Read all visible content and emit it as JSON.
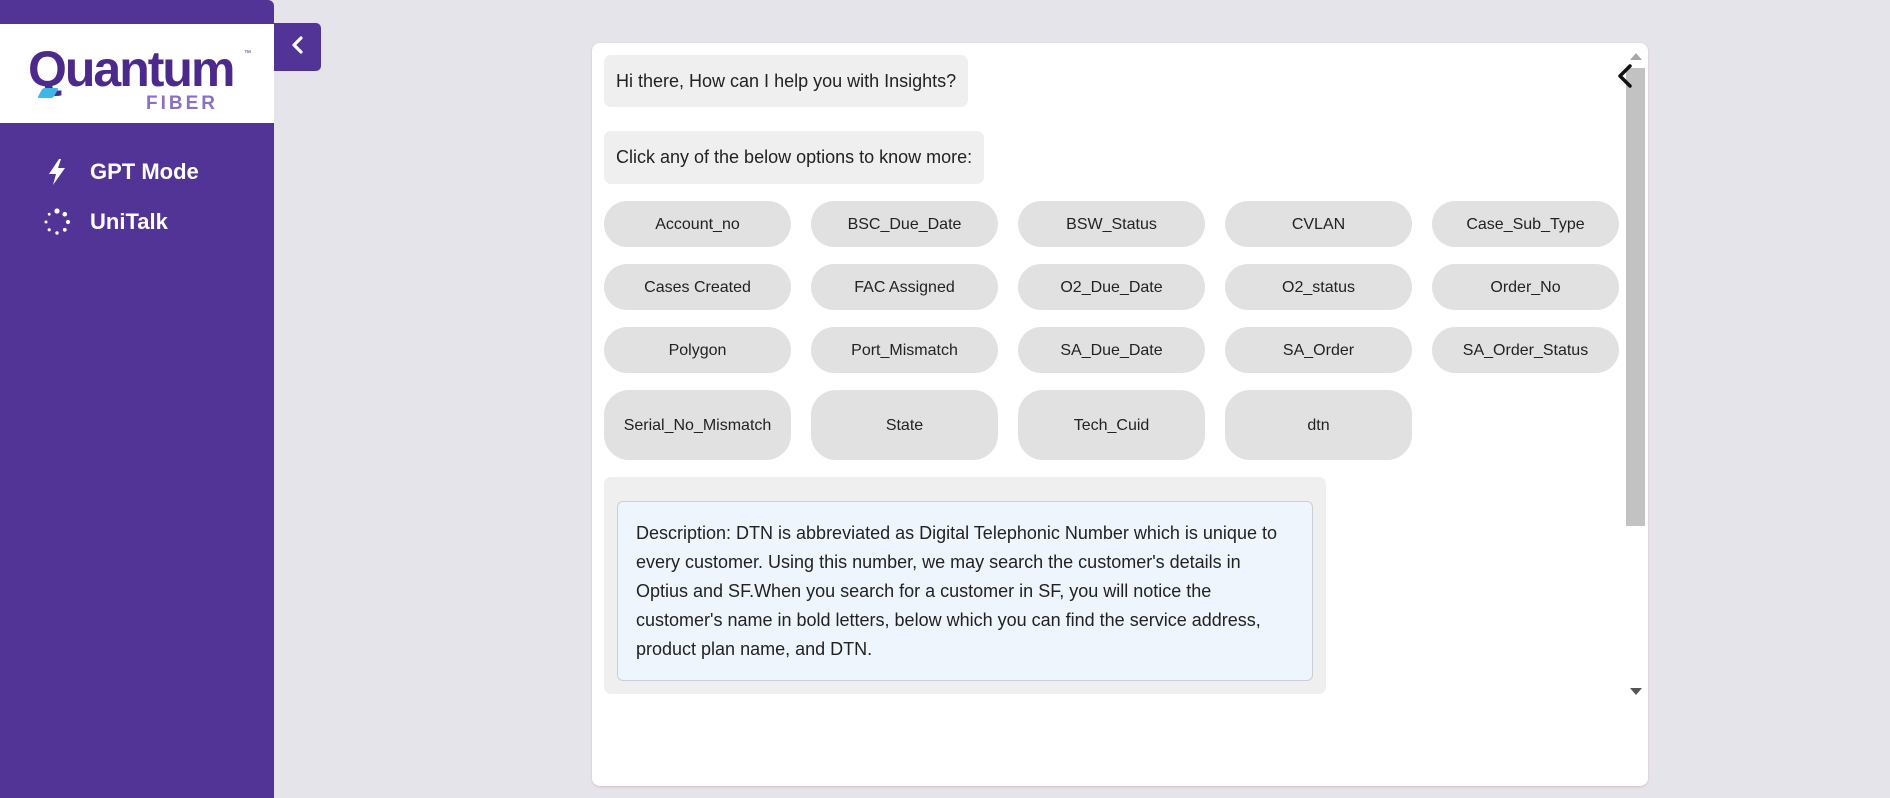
{
  "brand": {
    "logo_text": "Quantum",
    "logo_sub": "FIBER",
    "trademark": "™",
    "accent_color": "#523396"
  },
  "sidebar": {
    "items": [
      {
        "label": "GPT Mode",
        "icon": "lightning-bolt-icon"
      },
      {
        "label": "UniTalk",
        "icon": "loading-spinner-icon"
      }
    ],
    "collapse_icon": "chevron-left-icon"
  },
  "chat": {
    "greeting": "Hi there, How can I help you with Insights?",
    "prompt": "Click any of the below options to know more:",
    "options": [
      "Account_no",
      "BSC_Due_Date",
      "BSW_Status",
      "CVLAN",
      "Case_Sub_Type",
      "Cases Created",
      "FAC Assigned",
      "O2_Due_Date",
      "O2_status",
      "Order_No",
      "Polygon",
      "Port_Mismatch",
      "SA_Due_Date",
      "SA_Order",
      "SA_Order_Status",
      "Serial_No_Mismatch",
      "State",
      "Tech_Cuid",
      "dtn"
    ],
    "description": "Description: DTN is abbreviated as Digital Telephonic Number which is unique to every customer. Using this number, we may search the customer's details in Optius and SF.When you search for a customer in SF, you will notice the customer's name in bold letters, below which you can find the service address, product plan name, and DTN.",
    "back_icon": "chevron-left-icon"
  }
}
